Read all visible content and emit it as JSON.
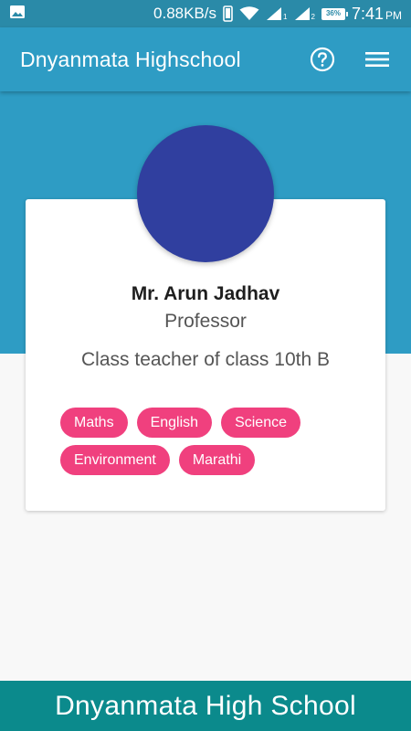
{
  "status_bar": {
    "network_speed": "0.88KB/s",
    "sim_label_1": "1",
    "sim_label_2": "2",
    "battery": "36%",
    "time": "7:41",
    "ampm": "PM",
    "icons": [
      "image-icon",
      "phone-icon",
      "wifi-icon",
      "signal-icon",
      "signal-icon",
      "battery-icon"
    ]
  },
  "app_bar": {
    "title": "Dnyanmata Highschool",
    "help_icon": "help-circle-icon",
    "menu_icon": "hamburger-menu-icon"
  },
  "profile": {
    "name": "Mr. Arun Jadhav",
    "role": "Professor",
    "description": "Class teacher of class 10th B",
    "subjects": [
      "Maths",
      "English",
      "Science",
      "Environment",
      "Marathi"
    ]
  },
  "footer": {
    "text": "Dnyanmata High School"
  },
  "colors": {
    "status_bar": "#2a8aa8",
    "primary": "#2e9cc4",
    "avatar": "#303f9f",
    "chip": "#f0407e",
    "footer": "#0b8a8c",
    "background": "#f8f8f8"
  }
}
